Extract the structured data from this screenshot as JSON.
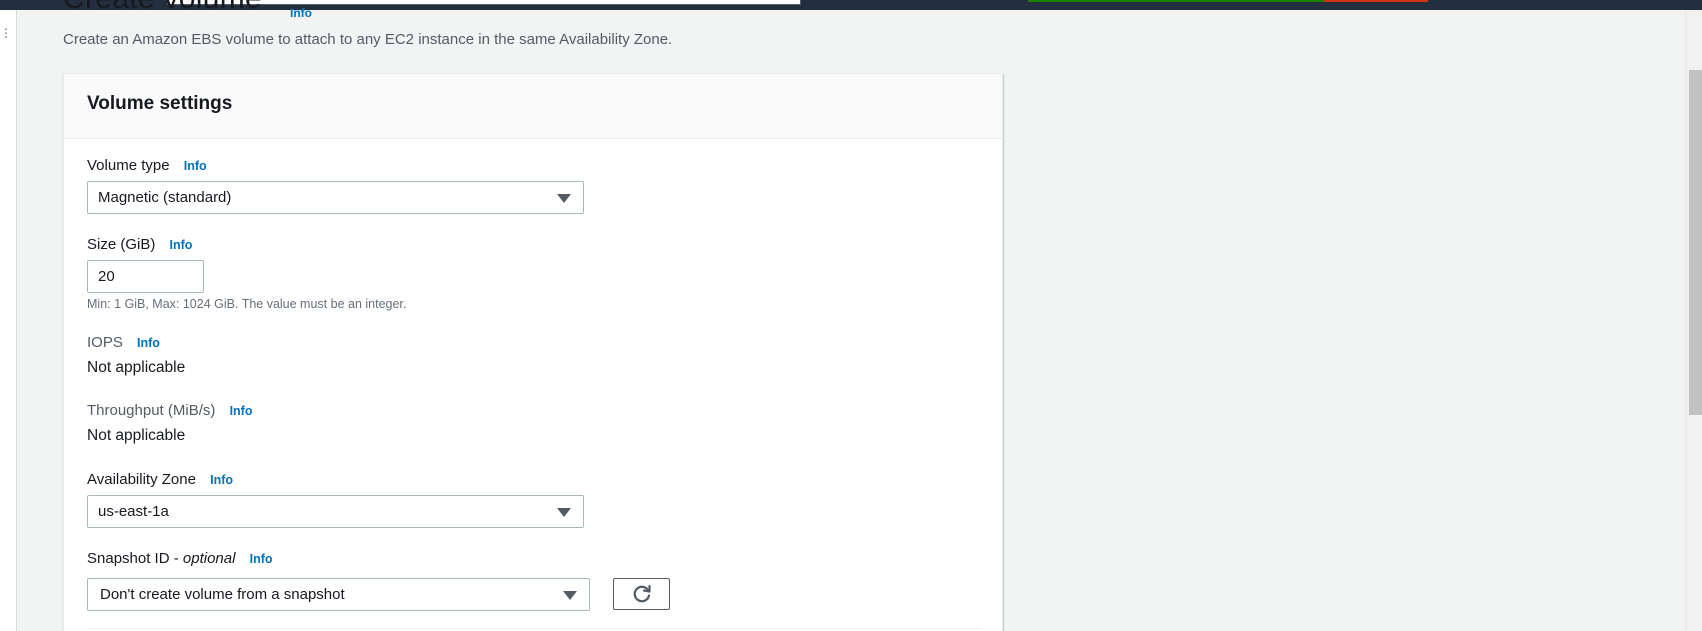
{
  "header": {
    "title": "Create volume",
    "title_info": "Info",
    "description": "Create an Amazon EBS volume to attach to any EC2 instance in the same Availability Zone."
  },
  "panel": {
    "title": "Volume settings",
    "volume_type": {
      "label": "Volume type",
      "info": "Info",
      "value": "Magnetic (standard)"
    },
    "size": {
      "label": "Size (GiB)",
      "info": "Info",
      "value": "20",
      "hint": "Min: 1 GiB, Max: 1024 GiB. The value must be an integer."
    },
    "iops": {
      "label": "IOPS",
      "info": "Info",
      "value": "Not applicable"
    },
    "throughput": {
      "label": "Throughput (MiB/s)",
      "info": "Info",
      "value": "Not applicable"
    },
    "availability_zone": {
      "label": "Availability Zone",
      "info": "Info",
      "value": "us-east-1a"
    },
    "snapshot": {
      "label": "Snapshot ID - ",
      "label_optional": "optional",
      "info": "Info",
      "value": "Don't create volume from a snapshot",
      "refresh_icon": "refresh-icon"
    }
  },
  "colors": {
    "link": "#0073bb",
    "background": "#f2f3f3",
    "topbar": "#232f3e"
  }
}
